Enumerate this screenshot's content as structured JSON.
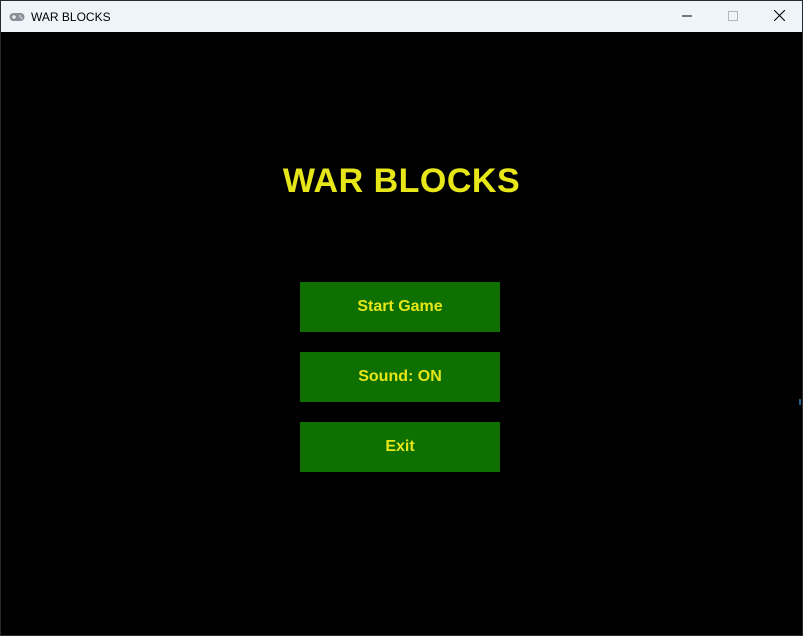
{
  "window": {
    "title": "WAR BLOCKS",
    "icon": "gamepad-icon",
    "controls": [
      "minimize-icon",
      "maximize-icon",
      "close-icon"
    ]
  },
  "game": {
    "title": "WAR BLOCKS",
    "menu": {
      "start_label": "Start Game",
      "sound_label": "Sound: ON",
      "exit_label": "Exit"
    }
  },
  "colors": {
    "background": "#000000",
    "button": "#0d7000",
    "text": "#e6e619",
    "titlebar": "#eef5fa"
  }
}
